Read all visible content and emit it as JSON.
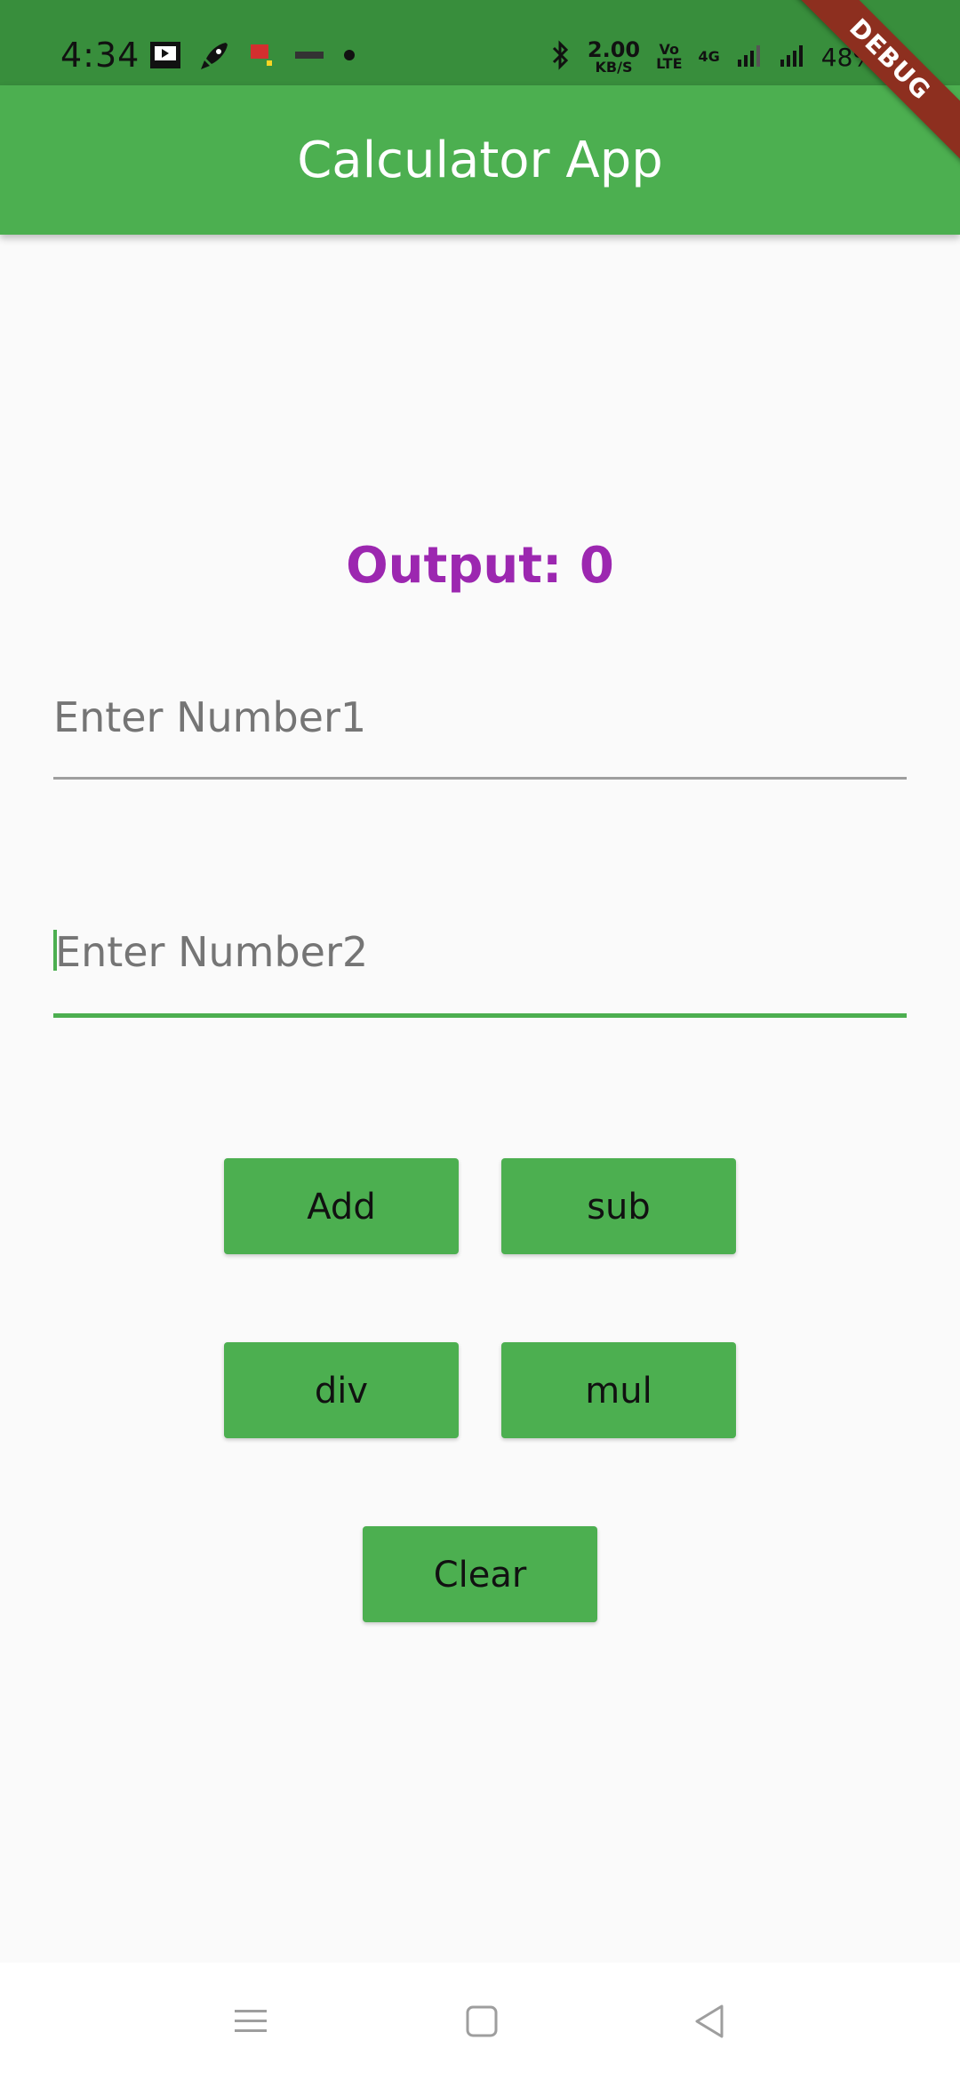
{
  "status_bar": {
    "time": "4:34",
    "net_speed_value": "2.00",
    "net_speed_unit": "KB/S",
    "volte_top": "Vo",
    "volte_bottom": "LTE",
    "network": "4G",
    "battery": "48%"
  },
  "debug_banner": "DEBUG",
  "app_bar": {
    "title": "Calculator App"
  },
  "output": {
    "label": "Output: 0"
  },
  "inputs": {
    "number1_placeholder": "Enter Number1",
    "number2_placeholder": "Enter Number2"
  },
  "buttons": {
    "add": "Add",
    "sub": "sub",
    "div": "div",
    "mul": "mul",
    "clear": "Clear"
  },
  "colors": {
    "app_bar": "#4caf50",
    "status_bar": "#388e3c",
    "output_text": "#9c27b0",
    "button": "#4caf50"
  },
  "icons": {
    "status_left": [
      "screen-cast-icon",
      "rocket-icon",
      "app-notification-icon",
      "app-notification-icon-2",
      "dot-icon"
    ],
    "status_right": [
      "bluetooth-icon",
      "signal-icon",
      "signal-icon-2",
      "battery-icon"
    ],
    "nav": [
      "menu-icon",
      "home-icon",
      "back-icon"
    ]
  }
}
